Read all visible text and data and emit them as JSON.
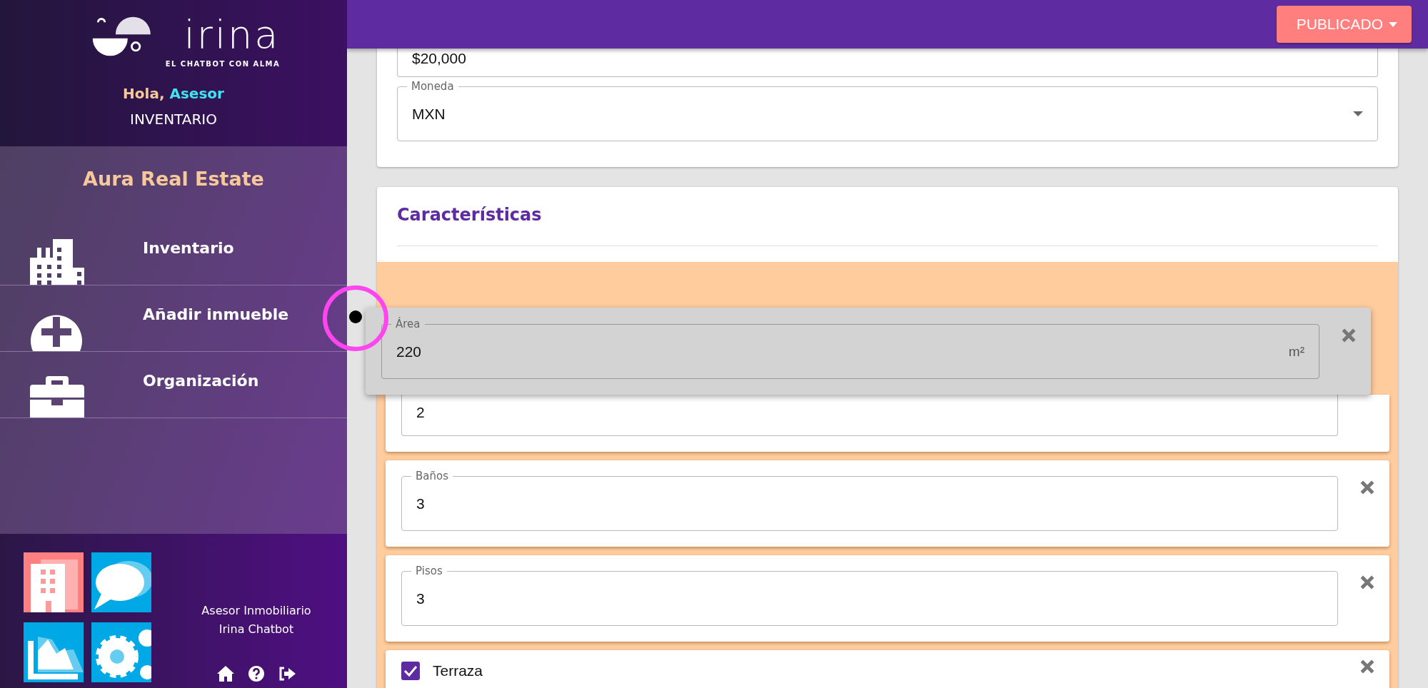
{
  "sidebar": {
    "logo": {
      "wordmark": "irina",
      "tagline": "EL CHATBOT CON ALMA"
    },
    "greeting": {
      "prefix": "Hola,",
      "name": "Asesor"
    },
    "section": "INVENTARIO",
    "company": "Aura Real Estate",
    "nav": [
      {
        "kind": "inventory",
        "label": "Inventario"
      },
      {
        "kind": "add",
        "label": "Añadir inmueble"
      },
      {
        "kind": "organization",
        "label": "Organización"
      }
    ],
    "footer": {
      "lines": [
        "Asesor Inmobiliario",
        "Irina Chatbot"
      ]
    }
  },
  "header": {
    "status_button": "PUBLICADO"
  },
  "price_card": {
    "fields": [
      {
        "kind": "text",
        "value": "$20,000"
      },
      {
        "kind": "select",
        "label": "Moneda",
        "value": "MXN"
      }
    ]
  },
  "features": {
    "title": "Características",
    "items": [
      {
        "kind": "field",
        "label": "Área",
        "value": "220",
        "unit": "m²",
        "dragging": true
      },
      {
        "kind": "field",
        "value": "2",
        "dragging": false
      },
      {
        "kind": "field",
        "label": "Baños",
        "value": "3",
        "dragging": false
      },
      {
        "kind": "field",
        "label": "Pisos",
        "value": "3",
        "dragging": false
      },
      {
        "kind": "checkbox",
        "label": "Terraza",
        "checked": true,
        "dragging": false
      }
    ]
  }
}
